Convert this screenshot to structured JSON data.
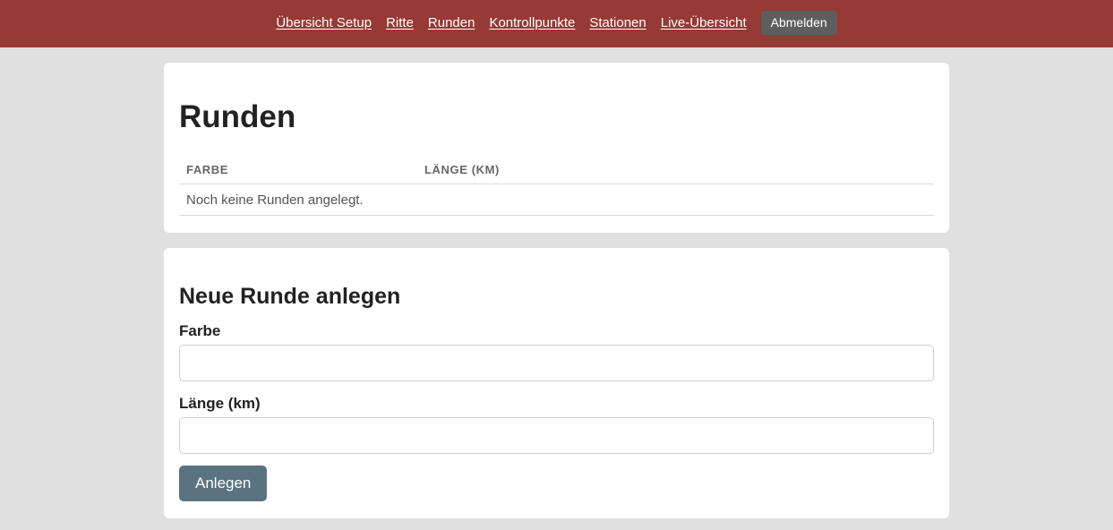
{
  "nav": {
    "links": [
      {
        "label": "Übersicht Setup"
      },
      {
        "label": "Ritte"
      },
      {
        "label": "Runden"
      },
      {
        "label": "Kontrollpunkte"
      },
      {
        "label": "Stationen"
      },
      {
        "label": "Live-Übersicht"
      }
    ],
    "logout_label": "Abmelden"
  },
  "rounds": {
    "title": "Runden",
    "columns": [
      "FARBE",
      "LÄNGE (KM)"
    ],
    "empty_message": "Noch keine Runden angelegt."
  },
  "form": {
    "title": "Neue Runde anlegen",
    "color_label": "Farbe",
    "color_value": "",
    "length_label": "Länge (km)",
    "length_value": "",
    "submit_label": "Anlegen"
  },
  "colors": {
    "header_bg": "#973934",
    "logout_bg": "#5e5e5e",
    "submit_bg": "#5a7380",
    "page_bg": "#e0e0e0"
  }
}
